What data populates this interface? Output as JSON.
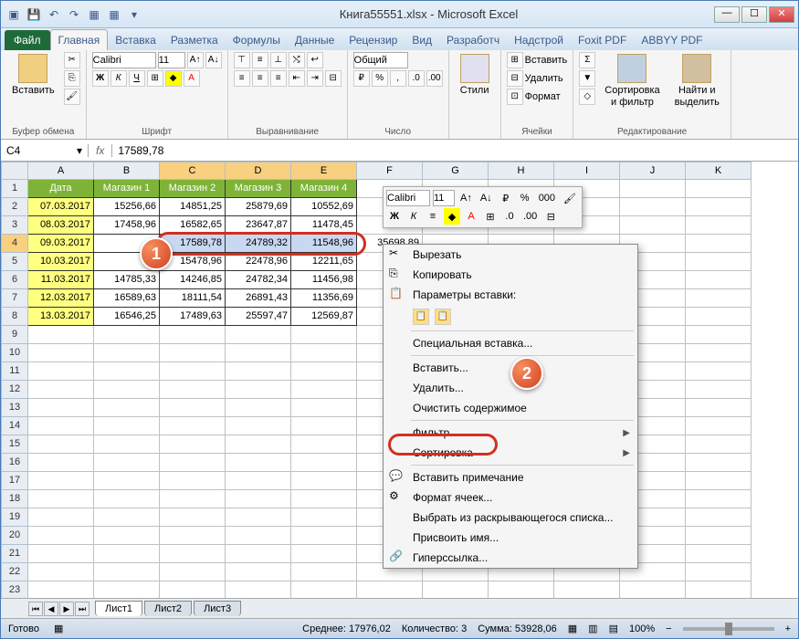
{
  "title": "Книга55551.xlsx - Microsoft Excel",
  "tabs": {
    "file": "Файл",
    "items": [
      "Главная",
      "Вставка",
      "Разметка",
      "Формулы",
      "Данные",
      "Рецензир",
      "Вид",
      "Разработч",
      "Надстрой",
      "Foxit PDF",
      "ABBYY PDF"
    ]
  },
  "ribbon": {
    "clipboard": {
      "label": "Буфер обмена",
      "paste": "Вставить"
    },
    "font": {
      "label": "Шрифт",
      "name": "Calibri",
      "size": "11"
    },
    "alignment": {
      "label": "Выравнивание"
    },
    "number": {
      "label": "Число",
      "format": "Общий"
    },
    "styles": {
      "label": "",
      "btn": "Стили"
    },
    "cells": {
      "label": "Ячейки",
      "insert": "Вставить",
      "delete": "Удалить",
      "format": "Формат"
    },
    "editing": {
      "label": "Редактирование",
      "sort": "Сортировка\nи фильтр",
      "find": "Найти и\nвыделить"
    }
  },
  "namebox": "C4",
  "formula": "17589,78",
  "columns": [
    "A",
    "B",
    "C",
    "D",
    "E",
    "F",
    "G",
    "H",
    "I",
    "J",
    "K"
  ],
  "row_headers": [
    1,
    2,
    3,
    4,
    5,
    6,
    7,
    8,
    9,
    10,
    11,
    12,
    13,
    14,
    15,
    16,
    17,
    18,
    19,
    20,
    21,
    22,
    23
  ],
  "table": {
    "headers": [
      "Дата",
      "Магазин 1",
      "Магазин 2",
      "Магазин 3",
      "Магазин 4"
    ],
    "rows": [
      [
        "07.03.2017",
        "15256,66",
        "14851,25",
        "25879,69",
        "10552,69"
      ],
      [
        "08.03.2017",
        "17458,96",
        "16582,65",
        "23647,87",
        "11478,45"
      ],
      [
        "09.03.2017",
        "",
        "17589,78",
        "24789,32",
        "11548,96"
      ],
      [
        "10.03.2017",
        "",
        "15478,96",
        "22478,96",
        "12211,65"
      ],
      [
        "11.03.2017",
        "14785,33",
        "14246,85",
        "24782,34",
        "11456,98"
      ],
      [
        "12.03.2017",
        "16589,63",
        "18111,54",
        "26891,43",
        "11356,69"
      ],
      [
        "13.03.2017",
        "16546,25",
        "17489,63",
        "25597,47",
        "12569,87"
      ]
    ],
    "overlay": {
      "b4": "35698,89"
    }
  },
  "selected_cells": [
    "C4",
    "D4",
    "E4"
  ],
  "mini_toolbar": {
    "font": "Calibri",
    "size": "11",
    "percent": "%",
    "thousands": "000"
  },
  "context_menu": {
    "cut": "Вырезать",
    "copy": "Копировать",
    "paste_opts": "Параметры вставки:",
    "paste_special": "Специальная вставка...",
    "insert": "Вставить...",
    "delete": "Удалить...",
    "clear": "Очистить содержимое",
    "filter": "Фильтр",
    "sort": "Сортировка",
    "comment": "Вставить примечание",
    "format_cells": "Формат ячеек...",
    "pick_list": "Выбрать из раскрывающегося списка...",
    "define_name": "Присвоить имя...",
    "hyperlink": "Гиперссылка..."
  },
  "sheets": [
    "Лист1",
    "Лист2",
    "Лист3"
  ],
  "status": {
    "ready": "Готово",
    "avg_label": "Среднее:",
    "avg": "17976,02",
    "count_label": "Количество:",
    "count": "3",
    "sum_label": "Сумма:",
    "sum": "53928,06",
    "zoom": "100%"
  },
  "callouts": {
    "one": "1",
    "two": "2"
  }
}
